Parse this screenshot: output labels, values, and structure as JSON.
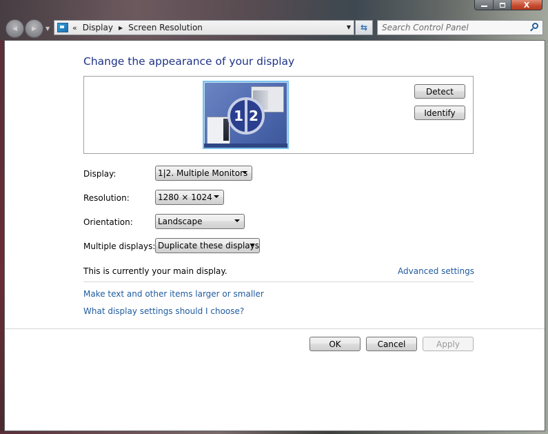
{
  "window": {
    "caption_buttons": {
      "minimize_icon": "minimize-icon",
      "maximize_icon": "maximize-icon",
      "close_icon": "close-icon",
      "close_glyph": "X"
    }
  },
  "navigation": {
    "back_glyph": "◀",
    "forward_glyph": "▶",
    "recent_glyph": "▼"
  },
  "address_bar": {
    "overflow_glyph": "«",
    "breadcrumbs": [
      "Display",
      "Screen Resolution"
    ],
    "separator_glyph": "▶",
    "dropdown_glyph": "▼",
    "refresh_glyph": "⇆"
  },
  "search": {
    "placeholder": "Search Control Panel",
    "value": ""
  },
  "main": {
    "heading": "Change the appearance of your display",
    "preview": {
      "monitor_numbers": [
        "1",
        "2"
      ]
    },
    "detect_label": "Detect",
    "identify_label": "Identify",
    "fields": {
      "display": {
        "label": "Display:",
        "value": "1|2. Multiple Monitors"
      },
      "resolution": {
        "label": "Resolution:",
        "value": "1280 × 1024"
      },
      "orientation": {
        "label": "Orientation:",
        "value": "Landscape"
      },
      "multiple_displays": {
        "label": "Multiple displays:",
        "value": "Duplicate these displays"
      }
    },
    "main_display_text": "This is currently your main display.",
    "advanced_settings_link": "Advanced settings",
    "links": [
      "Make text and other items larger or smaller",
      "What display settings should I choose?"
    ]
  },
  "footer": {
    "ok_label": "OK",
    "cancel_label": "Cancel",
    "apply_label": "Apply",
    "apply_enabled": false
  },
  "colors": {
    "heading": "#1e3287",
    "link": "#1e5a9e",
    "close_button": "#c54a2f"
  }
}
